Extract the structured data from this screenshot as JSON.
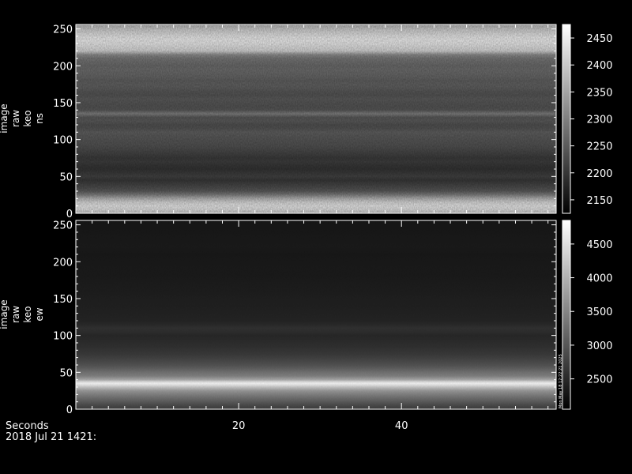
{
  "chart_data": [
    {
      "type": "heatmap",
      "title": "",
      "ylabel_lines": [
        "image",
        "raw",
        "keo",
        "ns"
      ],
      "xlim": [
        0,
        59
      ],
      "ylim": [
        0,
        256
      ],
      "yticks": [
        0,
        50,
        100,
        150,
        200,
        250
      ],
      "colorbar": {
        "min": 2125,
        "max": 2475,
        "ticks": [
          2150,
          2200,
          2250,
          2300,
          2350,
          2400,
          2450
        ]
      },
      "row_profile": {
        "y": [
          0,
          5,
          10,
          15,
          20,
          25,
          30,
          35,
          40,
          45,
          50,
          55,
          60,
          65,
          70,
          75,
          80,
          85,
          90,
          95,
          100,
          105,
          110,
          115,
          120,
          125,
          130,
          135,
          140,
          145,
          150,
          155,
          160,
          165,
          170,
          175,
          180,
          185,
          190,
          195,
          200,
          205,
          210,
          215,
          220,
          225,
          230,
          235,
          240,
          245,
          250,
          256
        ],
        "value": [
          2390,
          2430,
          2440,
          2420,
          2370,
          2300,
          2250,
          2230,
          2215,
          2200,
          2215,
          2205,
          2195,
          2200,
          2210,
          2205,
          2215,
          2225,
          2235,
          2240,
          2245,
          2250,
          2255,
          2240,
          2235,
          2250,
          2245,
          2300,
          2245,
          2240,
          2245,
          2250,
          2240,
          2245,
          2255,
          2260,
          2255,
          2265,
          2270,
          2275,
          2270,
          2280,
          2290,
          2320,
          2415,
          2430,
          2445,
          2450,
          2440,
          2420,
          2400,
          2360
        ]
      }
    },
    {
      "type": "heatmap",
      "title": "",
      "ylabel_lines": [
        "image",
        "raw",
        "keo",
        "ew"
      ],
      "xlim": [
        0,
        59
      ],
      "ylim": [
        0,
        256
      ],
      "yticks": [
        0,
        50,
        100,
        150,
        200,
        250
      ],
      "colorbar": {
        "min": 2050,
        "max": 4850,
        "ticks": [
          2500,
          3000,
          3500,
          4000,
          4500
        ]
      },
      "row_profile": {
        "y": [
          0,
          5,
          10,
          15,
          20,
          25,
          30,
          33,
          35,
          37,
          40,
          45,
          50,
          55,
          60,
          65,
          70,
          75,
          80,
          85,
          90,
          95,
          100,
          105,
          110,
          115,
          120,
          130,
          140,
          150,
          160,
          170,
          180,
          190,
          200,
          210,
          220,
          230,
          240,
          250,
          256
        ],
        "value": [
          2700,
          2850,
          3050,
          3250,
          3450,
          3700,
          4200,
          4550,
          4700,
          4500,
          3900,
          3450,
          3300,
          3100,
          2950,
          2850,
          2750,
          2680,
          2630,
          2580,
          2540,
          2510,
          2490,
          2560,
          2590,
          2500,
          2440,
          2420,
          2400,
          2390,
          2370,
          2360,
          2340,
          2330,
          2320,
          2310,
          2330,
          2320,
          2310,
          2300,
          2290
        ]
      }
    }
  ],
  "x_axis": {
    "label": "Seconds",
    "ticks": [
      20,
      40
    ]
  },
  "footer_date": "2018 Jul 21 1421:",
  "side_stamp": "Mon May 18 12:22:21 2025",
  "colors": {
    "background": "#000000",
    "foreground": "#ffffff"
  }
}
